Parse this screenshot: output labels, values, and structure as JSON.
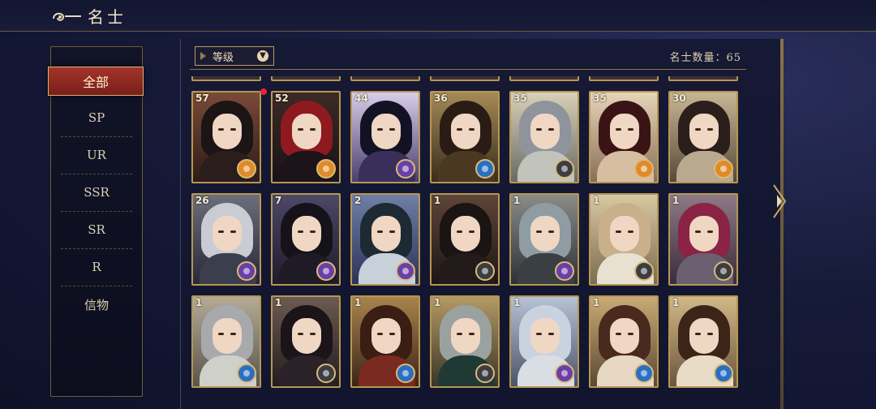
{
  "header": {
    "title": "名士"
  },
  "sidebar": {
    "items": [
      {
        "label": "全部"
      },
      {
        "label": "SP"
      },
      {
        "label": "UR"
      },
      {
        "label": "SSR"
      },
      {
        "label": "SR"
      },
      {
        "label": "R"
      },
      {
        "label": "信物"
      }
    ],
    "active": "全部"
  },
  "toolbar": {
    "sort_label": "等级",
    "count_text": "名士数量：65"
  },
  "colors": {
    "accent_gold": "#b59654",
    "active_red": "#a3342c",
    "notify_red": "#e3263a"
  },
  "cards": [
    {
      "level": "57",
      "hair": "#1d1416",
      "robe": "#2a1d1b",
      "c1": "#7a4a38",
      "c2": "#2d1c18",
      "badge": "#e08a2a",
      "notify": true
    },
    {
      "level": "52",
      "hair": "#8e1a1f",
      "robe": "#1c1418",
      "c1": "#3c2a26",
      "c2": "#18121a",
      "badge": "#e08a2a"
    },
    {
      "level": "44",
      "hair": "#121224",
      "robe": "#3a2f5a",
      "c1": "#d8cde8",
      "c2": "#4b3f6e",
      "badge": "#6b3fa8"
    },
    {
      "level": "36",
      "hair": "#2a1c15",
      "robe": "#4a3920",
      "c1": "#a58a56",
      "c2": "#3a2d1d",
      "badge": "#2a6fc2"
    },
    {
      "level": "35",
      "hair": "#8f949c",
      "robe": "#c2c3ba",
      "c1": "#d9d0b8",
      "c2": "#6b6a63",
      "badge": "#3b3d42"
    },
    {
      "level": "35",
      "hair": "#3a1414",
      "robe": "#d6bfa0",
      "c1": "#e6d5b9",
      "c2": "#8a6f56",
      "badge": "#e08a2a"
    },
    {
      "level": "30",
      "hair": "#2b1f1c",
      "robe": "#b9aa8f",
      "c1": "#c9b693",
      "c2": "#584a38",
      "badge": "#e08a2a"
    },
    {
      "level": "26",
      "hair": "#c9ccd2",
      "robe": "#3b3f4d",
      "c1": "#6c6e7a",
      "c2": "#27283a",
      "badge": "#6b3fa8"
    },
    {
      "level": "7",
      "hair": "#151219",
      "robe": "#1f1b26",
      "c1": "#4c4866",
      "c2": "#1e1b2e",
      "badge": "#6b3fa8"
    },
    {
      "level": "2",
      "hair": "#1e2a33",
      "robe": "#c8d0da",
      "c1": "#6f7fa6",
      "c2": "#2c3358",
      "badge": "#6b3fa8"
    },
    {
      "level": "1",
      "hair": "#1a1412",
      "robe": "#231b1a",
      "c1": "#5e4538",
      "c2": "#1e1614",
      "badge": "#3b3d42"
    },
    {
      "level": "1",
      "hair": "#8f9ca3",
      "robe": "#3a3f44",
      "c1": "#8a8c88",
      "c2": "#2e3034",
      "badge": "#6b3fa8"
    },
    {
      "level": "1",
      "hair": "#c9b08a",
      "robe": "#e8e0d0",
      "c1": "#d8c9a4",
      "c2": "#7d6b4e",
      "badge": "#3b3d42"
    },
    {
      "level": "1",
      "hair": "#8a2346",
      "robe": "#6a6070",
      "c1": "#8e7a86",
      "c2": "#3a2c3c",
      "badge": "#3b3d42"
    },
    {
      "level": "1",
      "hair": "#a7a9ad",
      "robe": "#cfd0c8",
      "c1": "#b3ab96",
      "c2": "#5a554a",
      "badge": "#2a6fc2"
    },
    {
      "level": "1",
      "hair": "#1b1418",
      "robe": "#2a2228",
      "c1": "#6c5a52",
      "c2": "#231c1e",
      "badge": "#3b3d42"
    },
    {
      "level": "1",
      "hair": "#3a1e14",
      "robe": "#7a2a20",
      "c1": "#a8844c",
      "c2": "#3c2418",
      "badge": "#2a6fc2"
    },
    {
      "level": "1",
      "hair": "#9aa2a0",
      "robe": "#1f3a34",
      "c1": "#b49a64",
      "c2": "#3a3526",
      "badge": "#3b3d42"
    },
    {
      "level": "1",
      "hair": "#c9d3e0",
      "robe": "#d9dde4",
      "c1": "#b7c2d4",
      "c2": "#4c5468",
      "badge": "#6b3fa8"
    },
    {
      "level": "1",
      "hair": "#4a2a1e",
      "robe": "#e6d8c2",
      "c1": "#c9ab76",
      "c2": "#5c4834",
      "badge": "#2a6fc2"
    },
    {
      "level": "1",
      "hair": "#3c2418",
      "robe": "#e8dcc6",
      "c1": "#d2b888",
      "c2": "#6a563c",
      "badge": "#2a6fc2"
    }
  ]
}
